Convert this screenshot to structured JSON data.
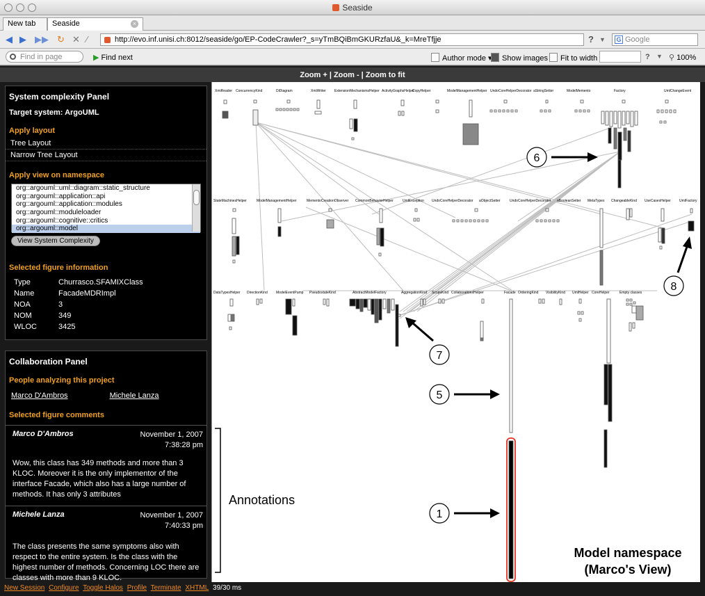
{
  "window": {
    "title": "Seaside"
  },
  "tabs": [
    {
      "label": "New tab"
    },
    {
      "label": "Seaside"
    }
  ],
  "nav": {
    "url": "http://evo.inf.unisi.ch:8012/seaside/go/EP-CodeCrawler?_s=yTmBQiBmGKURzfaU&_k=MreTfjje",
    "search_placeholder": "Google"
  },
  "findbar": {
    "placeholder": "Find in page",
    "find_next": "Find next",
    "author_mode": "Author mode",
    "show_images": "Show images",
    "fit": "Fit to width",
    "zoom": "100%"
  },
  "zoombar": {
    "text": "Zoom + | Zoom - | Zoom to fit"
  },
  "system_panel": {
    "title": "System complexity Panel",
    "target": "Target system: ArgoUML",
    "apply_layout_title": "Apply layout",
    "layouts": [
      "Tree Layout",
      "Narrow Tree Layout"
    ],
    "namespace_title": "Apply view on namespace",
    "namespaces": [
      "org::argouml::uml::diagram::static_structure",
      "org::argouml::application::api",
      "org::argouml::application::modules",
      "org::argouml::moduleloader",
      "org::argouml::cognitive::critics",
      "org::argouml::model"
    ],
    "button": "View System Complexity",
    "info_title": "Selected figure information",
    "info": [
      {
        "k": "Type",
        "v": "Churrasco.SFAMIXClass"
      },
      {
        "k": "Name",
        "v": "FacadeMDRImpl"
      },
      {
        "k": "NOA",
        "v": "3"
      },
      {
        "k": "NOM",
        "v": "349"
      },
      {
        "k": "WLOC",
        "v": "3425"
      }
    ]
  },
  "collab_panel": {
    "title": "Collaboration Panel",
    "people_title": "People analyzing this project",
    "people": [
      "Marco D'Ambros",
      "Michele Lanza"
    ],
    "comments_title": "Selected figure comments",
    "comments": [
      {
        "author": "Marco D'Ambros",
        "date": "November 1, 2007 7:38:28 pm",
        "text": "Wow, this class has 349 methods and more than 3 KLOC. Moreover it is the only implementor of the interface Facade, which also has a large number of methods. It has only 3 attributes"
      },
      {
        "author": "Michele Lanza",
        "date": "November 1, 2007 7:40:33 pm",
        "text": "The class presents the same symptoms also with respect to the entire system. Is the class with the highest number of methods. Concerning LOC there are classes with more than 9 KLOC."
      }
    ]
  },
  "viz": {
    "row1": [
      "XmiReader",
      "ConcurrencyKind",
      "DiDiagram",
      "XmiWriter",
      "ExtensionMechanismsHelper",
      "ActivityGraphsHelper",
      "CopyHelper",
      "ModelManagementHelper",
      "UndoCoreHelperDecorator",
      "aStringSetter",
      "ModelMemento",
      "Factory",
      "UmlChangeEvent"
    ],
    "row2": [
      "StateMachinesHelper",
      "ModelManagementHelper",
      "MementoCreationObserver",
      "CommonBehaviorHelper",
      "UmlException",
      "UndoCoreHelperDecorator",
      "aObjectSetter",
      "UndoCoreHelperDecorator",
      "aBooleanSetter",
      "MetaTypes",
      "ChangeableKind",
      "UseCasesHelper",
      "UmlFactory"
    ],
    "row3": [
      "DataTypesHelper",
      "DirectionKind",
      "ModelEventPump",
      "PseudostateKind",
      "AbstractModelFactory",
      "AggregationKind",
      "ScopeKind",
      "CollaborationsHelper",
      "Facade",
      "OrderingKind",
      "VisibilityKind",
      "UmlHelper",
      "CoreHelper",
      "Empty classes"
    ],
    "annotations_label": "Annotations",
    "markers": [
      "1",
      "5",
      "6",
      "7",
      "8"
    ],
    "caption_line1": "Model namespace",
    "caption_line2": "(Marco's View)"
  },
  "status": {
    "links": [
      "New Session",
      "Configure",
      "Toggle Halos",
      "Profile",
      "Terminate",
      "XHTML"
    ],
    "time": "39/30 ms"
  }
}
